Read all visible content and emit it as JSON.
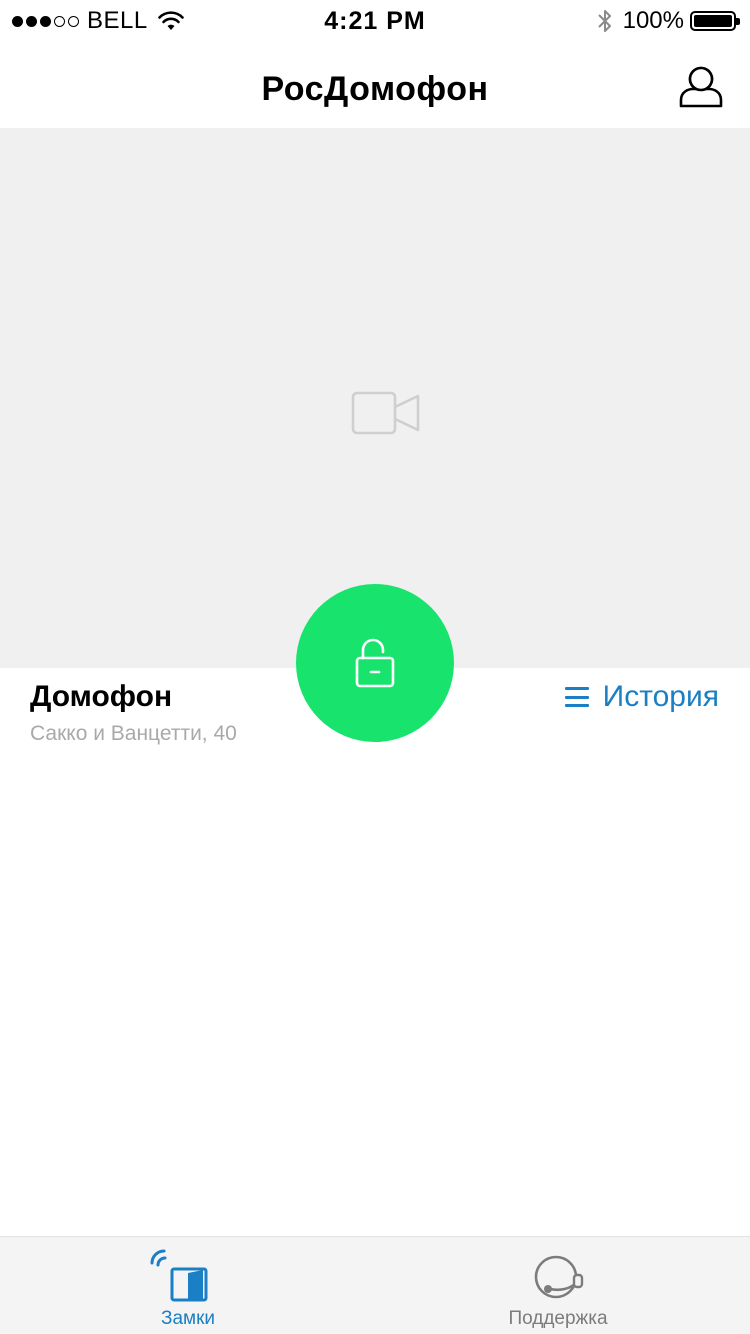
{
  "status_bar": {
    "carrier": "BELL",
    "time": "4:21 PM",
    "battery": "100%",
    "signal_dots_filled": 3,
    "signal_dots_total": 5
  },
  "nav": {
    "title": "РосДомофон",
    "profile_icon": "user-icon"
  },
  "camera": {
    "placeholder_icon": "video-camera-icon"
  },
  "unlock": {
    "icon": "unlocked-padlock-icon",
    "color": "#18e36d"
  },
  "intercom": {
    "title": "Домофон",
    "address": "Сакко и Ванцетти, 40"
  },
  "history": {
    "label": "История",
    "icon": "menu-list-icon",
    "color": "#1a7fc4"
  },
  "tabs": [
    {
      "label": "Замки",
      "icon": "door-lock-icon",
      "active": true,
      "color": "#1a7fc4"
    },
    {
      "label": "Поддержка",
      "icon": "headset-icon",
      "active": false,
      "color": "#7c7c7c"
    }
  ]
}
